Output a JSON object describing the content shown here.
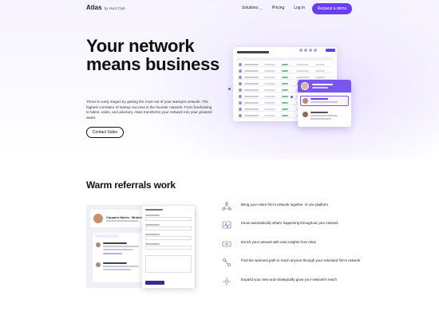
{
  "nav": {
    "brand": "Atlas",
    "brand_sub": "by Hunt Club",
    "links": [
      {
        "label": "Solutions",
        "has_dropdown": true
      },
      {
        "label": "Pricing",
        "has_dropdown": false
      },
      {
        "label": "Log in",
        "has_dropdown": false
      }
    ],
    "cta": "Request a demo"
  },
  "hero": {
    "title": "Your network means business",
    "description": "Thrive in early stages by getting the most out of your startup's network. The highest correlator of startup success is the founder network. From fundraising to talent, sales, and advisory, Atlas transforms your network into your greatest asset.",
    "button": "Contact Sales"
  },
  "section": {
    "title": "Warm referrals work",
    "profile_name": "Caryann Harris · Broker"
  },
  "features": [
    {
      "icon": "network-icon",
      "text": "Bring your entire firm's network together, in one platform"
    },
    {
      "icon": "pulse-icon",
      "text": "Know automatically what's happening throughout your network"
    },
    {
      "icon": "enrich-icon",
      "text": "Enrich your network with new insights from Atlas"
    },
    {
      "icon": "path-icon",
      "text": "Find the warmest path to reach anyone through your extended firm's network"
    },
    {
      "icon": "expand-icon",
      "text": "Expand your view and strategically grow your network's reach"
    }
  ],
  "colors": {
    "accent": "#6a3ef3",
    "hero_tint": "#f1ecff"
  }
}
